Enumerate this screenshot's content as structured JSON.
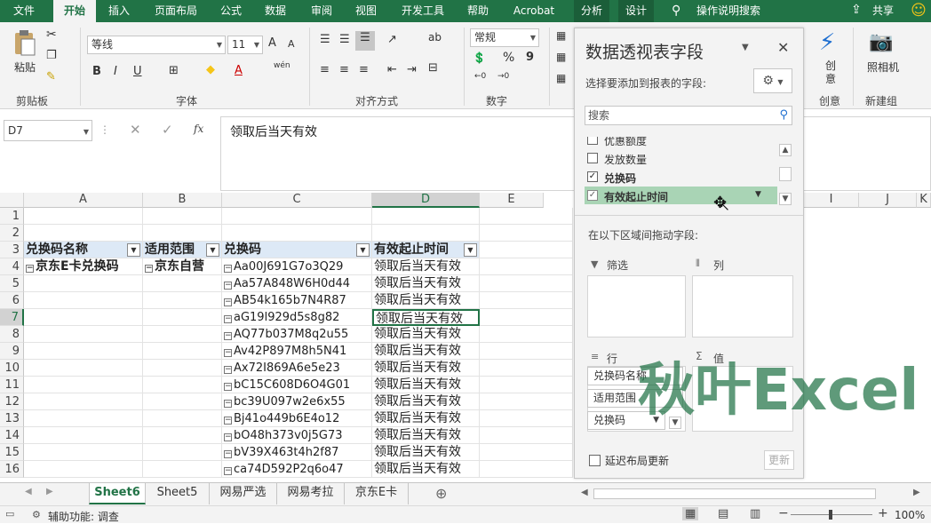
{
  "menu": {
    "tabs": [
      "文件",
      "开始",
      "插入",
      "页面布局",
      "公式",
      "数据",
      "审阅",
      "视图",
      "开发工具",
      "帮助",
      "Acrobat",
      "分析",
      "设计"
    ],
    "search_label": "操作说明搜索",
    "share_label": "共享",
    "smiley": "☺"
  },
  "ribbon": {
    "paste_label": "粘贴",
    "clipboard_label": "剪贴板",
    "font_name": "等线",
    "font_size": "11",
    "grow_font": "A",
    "shrink_font": "A",
    "bold": "B",
    "italic": "I",
    "underline": "U",
    "wen": "wén",
    "font_group_label": "字体",
    "align_group_label": "对齐方式",
    "number_format": "常规",
    "percent": "%",
    "comma": "9",
    "number_group_label": "数字",
    "create_label": "创意",
    "create_group_label": "创意",
    "camera_label": "照相机",
    "new_group_label": "新建组",
    "ab_icon": "ab",
    "accent": "#217346"
  },
  "formula_bar": {
    "name_box": "D7",
    "fx": "fx",
    "content": "领取后当天有效"
  },
  "columns": [
    "A",
    "B",
    "C",
    "D",
    "E",
    "I",
    "J",
    "K"
  ],
  "rows": [
    "1",
    "2",
    "3",
    "4",
    "5",
    "6",
    "7",
    "8",
    "9",
    "10",
    "11",
    "12",
    "13",
    "14",
    "15",
    "16"
  ],
  "table": {
    "headers": [
      "兑换码名称",
      "适用范围",
      "兑换码",
      "有效起止时间"
    ],
    "group_a": "京东E卡兑换码",
    "group_b": "京东自营",
    "codes": [
      "Aa00J691G7o3Q29",
      "Aa57A848W6H0d44",
      "AB54k165b7N4R87",
      "aG19l929d5s8g82",
      "AQ77b037M8q2u55",
      "Av42P897M8h5N41",
      "Ax72I869A6e5e23",
      "bC15C608D6O4G01",
      "bc39U097w2e6x55",
      "Bj41o449b6E4o12",
      "bO48h373v0j5G73",
      "bV39X463t4h2f87",
      "ca74D592P2q6o47"
    ],
    "validity": "领取后当天有效"
  },
  "sheets": [
    "Sheet6",
    "Sheet5",
    "网易严选",
    "网易考拉",
    "京东E卡"
  ],
  "status": {
    "accessibility": "辅助功能: 调查",
    "zoom": "100%"
  },
  "pivot_pane": {
    "title": "数据透视表字段",
    "subtitle": "选择要添加到报表的字段:",
    "search_placeholder": "搜索",
    "fields": [
      {
        "label": "优惠额度",
        "checked": false
      },
      {
        "label": "发放数量",
        "checked": false
      },
      {
        "label": "兑换码",
        "checked": true
      },
      {
        "label": "有效起止时间",
        "checked": true
      }
    ],
    "drag_hint": "在以下区域间拖动字段:",
    "filter_label": "筛选",
    "columns_label": "列",
    "rows_label": "行",
    "values_label": "值",
    "row_fields": [
      "兑换码名称",
      "适用范围",
      "兑换码"
    ],
    "defer_label": "延迟布局更新",
    "update_label": "更新"
  },
  "watermark": "秋叶Excel"
}
